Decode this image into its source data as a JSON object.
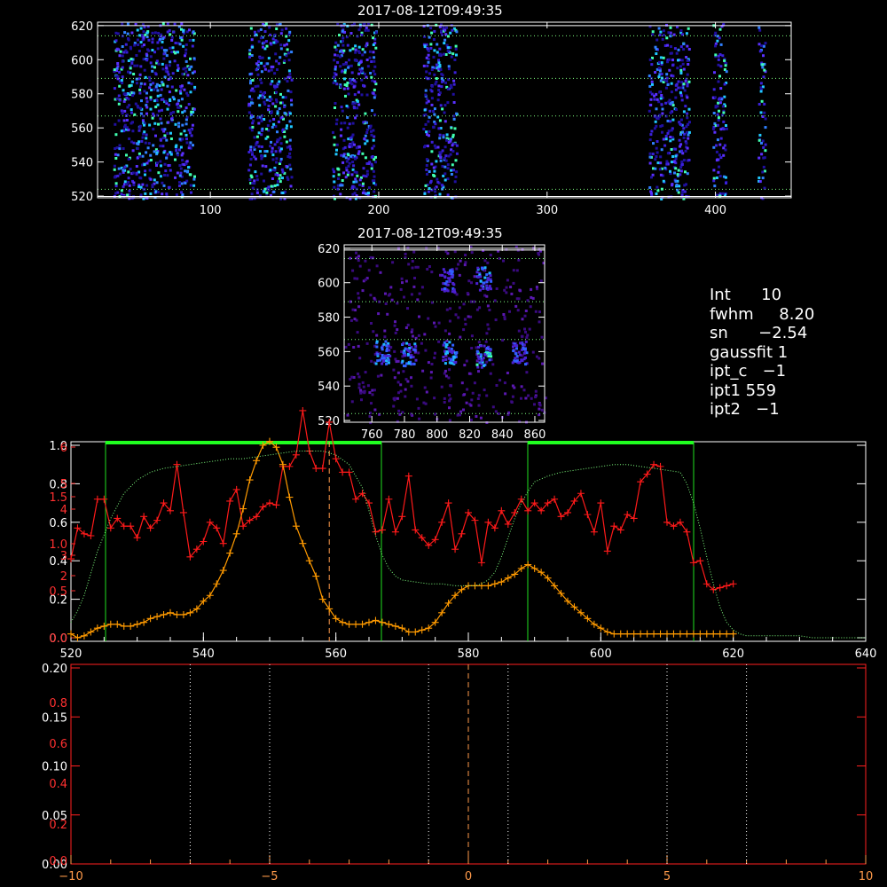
{
  "chart_data": [
    {
      "type": "heatmap",
      "title": "2017-08-12T09:49:35",
      "xlim": [
        33,
        445
      ],
      "ylim": [
        519,
        622
      ],
      "x_tick_labels": [
        "100",
        "200",
        "300",
        "400"
      ],
      "y_tick_labels": [
        "520",
        "540",
        "560",
        "580",
        "600",
        "620"
      ],
      "reference_lines_y": [
        524,
        567,
        589,
        614
      ],
      "white_lines_y": [
        519.8,
        620
      ],
      "bright_bands_x": [
        [
          42,
          90
        ],
        [
          122,
          148
        ],
        [
          172,
          198
        ],
        [
          226,
          246
        ],
        [
          360,
          384
        ],
        [
          398,
          406
        ],
        [
          425,
          429
        ]
      ],
      "colors": {
        "palette": [
          "#2010a0",
          "#3a20d8",
          "#5a30ff",
          "#3080ff",
          "#20c8ff",
          "#40ffb0"
        ]
      }
    },
    {
      "type": "heatmap",
      "title": "2017-08-12T09:49:35",
      "xlim": [
        743,
        866
      ],
      "ylim": [
        519,
        622
      ],
      "x_tick_labels": [
        "760",
        "780",
        "800",
        "820",
        "840",
        "860"
      ],
      "y_tick_labels": [
        "520",
        "540",
        "560",
        "580",
        "600",
        "620"
      ],
      "reference_lines_y": [
        524,
        567,
        589,
        614
      ],
      "white_lines_y": [
        619,
        620
      ],
      "spots": [
        {
          "x": 766,
          "y": 560,
          "i": 0.6
        },
        {
          "x": 782,
          "y": 559,
          "i": 0.7
        },
        {
          "x": 807,
          "y": 560,
          "i": 0.75
        },
        {
          "x": 828,
          "y": 558,
          "i": 1.0
        },
        {
          "x": 850,
          "y": 560,
          "i": 0.5
        },
        {
          "x": 828,
          "y": 603,
          "i": 0.7
        },
        {
          "x": 806,
          "y": 602,
          "i": 0.45
        }
      ]
    },
    {
      "type": "line",
      "xlim": [
        520,
        640
      ],
      "x_tick_labels": [
        "520",
        "540",
        "560",
        "580",
        "600",
        "620",
        "640"
      ],
      "y_tick_labels_white": [
        "0.0",
        "0.2",
        "0.4",
        "0.6",
        "0.8",
        "1.0"
      ],
      "y_tick_labels_red": [
        "0.0",
        "0.5",
        "1.0",
        "1.5",
        "2",
        "3",
        "4",
        "5",
        "6"
      ],
      "dashed_vline_x": 559,
      "green_windows": [
        [
          520,
          567
        ],
        [
          589,
          614
        ]
      ],
      "series": [
        {
          "style": "red-plus",
          "color": "#ff1a1a",
          "x": [
            520,
            521,
            522,
            523,
            524,
            525,
            526,
            527,
            528,
            529,
            530,
            531,
            532,
            533,
            534,
            535,
            536,
            537,
            538,
            539,
            540,
            541,
            542,
            543,
            544,
            545,
            546,
            547,
            548,
            549,
            550,
            551,
            552,
            553,
            554,
            555,
            556,
            557,
            558,
            559,
            560,
            561,
            562,
            563,
            564,
            565,
            566,
            567,
            568,
            569,
            570,
            571,
            572,
            573,
            574,
            575,
            576,
            577,
            578,
            579,
            580,
            581,
            582,
            583,
            584,
            585,
            586,
            587,
            588,
            589,
            590,
            591,
            592,
            593,
            594,
            595,
            596,
            597,
            598,
            599,
            600,
            601,
            602,
            603,
            604,
            605,
            606,
            607,
            608,
            609,
            610,
            611,
            612,
            613,
            614,
            615,
            616,
            617,
            618,
            619,
            620
          ],
          "y": [
            0.41,
            0.57,
            0.54,
            0.53,
            0.72,
            0.72,
            0.57,
            0.62,
            0.58,
            0.58,
            0.52,
            0.63,
            0.57,
            0.61,
            0.7,
            0.66,
            0.9,
            0.65,
            0.42,
            0.46,
            0.5,
            0.6,
            0.57,
            0.49,
            0.71,
            0.77,
            0.58,
            0.61,
            0.63,
            0.68,
            0.7,
            0.69,
            0.89,
            0.89,
            0.95,
            1.18,
            0.97,
            0.88,
            0.88,
            1.12,
            0.93,
            0.86,
            0.86,
            0.72,
            0.75,
            0.7,
            0.55,
            0.56,
            0.72,
            0.55,
            0.63,
            0.84,
            0.56,
            0.52,
            0.48,
            0.51,
            0.6,
            0.7,
            0.46,
            0.54,
            0.65,
            0.61,
            0.39,
            0.6,
            0.57,
            0.66,
            0.59,
            0.65,
            0.72,
            0.66,
            0.7,
            0.66,
            0.7,
            0.72,
            0.63,
            0.65,
            0.71,
            0.75,
            0.64,
            0.55,
            0.7,
            0.45,
            0.58,
            0.56,
            0.64,
            0.62,
            0.81,
            0.85,
            0.9,
            0.89,
            0.6,
            0.58,
            0.6,
            0.55,
            0.39,
            0.4,
            0.28,
            0.25,
            0.26,
            0.27,
            0.28
          ]
        },
        {
          "style": "orange-plus",
          "color": "#ff9a00",
          "x": [
            520,
            521,
            522,
            523,
            524,
            525,
            526,
            527,
            528,
            529,
            530,
            531,
            532,
            533,
            534,
            535,
            536,
            537,
            538,
            539,
            540,
            541,
            542,
            543,
            544,
            545,
            546,
            547,
            548,
            549,
            550,
            551,
            552,
            553,
            554,
            555,
            556,
            557,
            558,
            559,
            560,
            561,
            562,
            563,
            564,
            565,
            566,
            567,
            568,
            569,
            570,
            571,
            572,
            573,
            574,
            575,
            576,
            577,
            578,
            579,
            580,
            581,
            582,
            583,
            584,
            585,
            586,
            587,
            588,
            589,
            590,
            591,
            592,
            593,
            594,
            595,
            596,
            597,
            598,
            599,
            600,
            601,
            602,
            603,
            604,
            605,
            606,
            607,
            608,
            609,
            610,
            611,
            612,
            613,
            614,
            615,
            616,
            617,
            618,
            619,
            620
          ],
          "y": [
            0.02,
            0.0,
            0.01,
            0.03,
            0.05,
            0.06,
            0.07,
            0.07,
            0.06,
            0.06,
            0.07,
            0.08,
            0.1,
            0.11,
            0.12,
            0.13,
            0.12,
            0.12,
            0.13,
            0.15,
            0.19,
            0.22,
            0.28,
            0.35,
            0.44,
            0.54,
            0.67,
            0.82,
            0.92,
            1.0,
            1.02,
            0.99,
            0.9,
            0.73,
            0.58,
            0.49,
            0.4,
            0.32,
            0.2,
            0.15,
            0.1,
            0.08,
            0.07,
            0.07,
            0.07,
            0.08,
            0.09,
            0.08,
            0.07,
            0.06,
            0.05,
            0.03,
            0.03,
            0.04,
            0.05,
            0.08,
            0.13,
            0.18,
            0.22,
            0.25,
            0.27,
            0.27,
            0.27,
            0.27,
            0.28,
            0.29,
            0.31,
            0.33,
            0.36,
            0.38,
            0.36,
            0.34,
            0.31,
            0.27,
            0.23,
            0.19,
            0.16,
            0.13,
            0.1,
            0.07,
            0.05,
            0.03,
            0.02,
            0.02,
            0.02,
            0.02,
            0.02,
            0.02,
            0.02,
            0.02,
            0.02,
            0.02,
            0.02,
            0.02,
            0.02,
            0.02,
            0.02,
            0.02,
            0.02,
            0.02,
            0.02
          ]
        },
        {
          "style": "green-dotted",
          "color": "#7fff7f",
          "x": [
            520,
            521,
            522,
            524,
            526,
            528,
            530,
            532,
            534,
            536,
            538,
            540,
            542,
            544,
            546,
            548,
            550,
            552,
            554,
            556,
            558,
            560,
            562,
            564,
            565,
            566,
            567,
            568,
            569,
            570,
            572,
            574,
            576,
            578,
            580,
            581,
            582,
            583,
            584,
            585,
            586,
            587,
            588,
            589,
            590,
            592,
            594,
            596,
            598,
            600,
            602,
            604,
            606,
            608,
            610,
            612,
            613,
            614,
            615,
            616,
            617,
            618,
            619,
            620,
            621,
            622,
            624,
            626,
            628,
            630,
            632,
            634,
            636,
            638,
            640
          ],
          "y": [
            0.08,
            0.14,
            0.22,
            0.45,
            0.62,
            0.75,
            0.82,
            0.86,
            0.88,
            0.89,
            0.9,
            0.91,
            0.92,
            0.93,
            0.93,
            0.94,
            0.95,
            0.96,
            0.97,
            0.97,
            0.97,
            0.95,
            0.9,
            0.78,
            0.66,
            0.53,
            0.43,
            0.36,
            0.32,
            0.3,
            0.29,
            0.28,
            0.28,
            0.27,
            0.27,
            0.27,
            0.28,
            0.3,
            0.34,
            0.42,
            0.52,
            0.62,
            0.7,
            0.76,
            0.81,
            0.84,
            0.86,
            0.87,
            0.88,
            0.89,
            0.9,
            0.9,
            0.89,
            0.88,
            0.87,
            0.86,
            0.8,
            0.7,
            0.57,
            0.42,
            0.28,
            0.16,
            0.08,
            0.04,
            0.02,
            0.01,
            0.01,
            0.01,
            0.01,
            0.01,
            0.0,
            0.0,
            0.0,
            0.0,
            0.0
          ]
        }
      ]
    },
    {
      "type": "line",
      "xlim": [
        -10,
        10
      ],
      "x_tick_labels": [
        "−10",
        "−5",
        "0",
        "5",
        "10"
      ],
      "y_tick_labels_white": [
        "0.00",
        "0.05",
        "0.10",
        "0.15",
        "0.20"
      ],
      "y_tick_labels_red": [
        "0.0",
        "0.2",
        "0.4",
        "0.6",
        "0.8"
      ],
      "dotted_vlines_x": [
        -7,
        -5,
        -1,
        1,
        5,
        7
      ],
      "dashed_vline_x": 0,
      "series": []
    }
  ],
  "info_panel": [
    {
      "label": "Int",
      "value": "10"
    },
    {
      "label": "fwhm",
      "value": "8.20"
    },
    {
      "label": "sn",
      "value": "−2.54"
    },
    {
      "label": "gaussfit",
      "value": "1"
    },
    {
      "label": "ipt_c",
      "value": "−1"
    },
    {
      "label": "ipt1",
      "value": "559"
    },
    {
      "label": "ipt2",
      "value": "−1"
    }
  ]
}
